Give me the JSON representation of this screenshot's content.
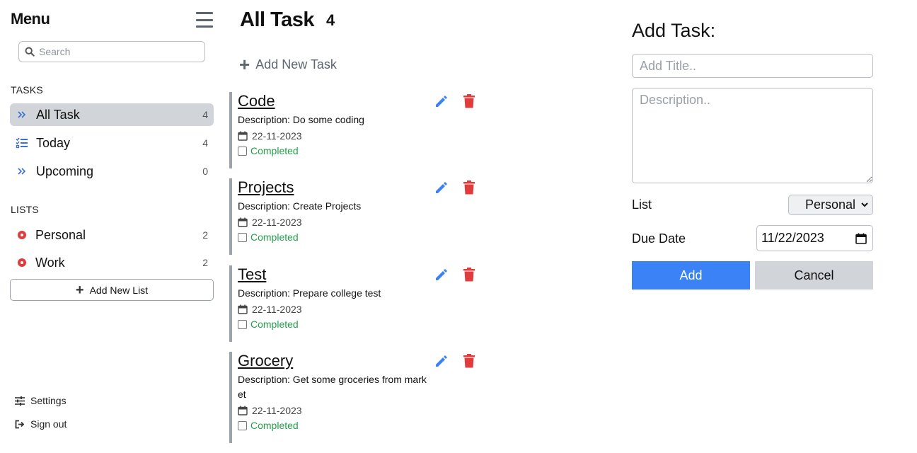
{
  "sidebar": {
    "title": "Menu",
    "search_placeholder": "Search",
    "tasks_label": "TASKS",
    "tasks": [
      {
        "label": "All Task",
        "count": "4",
        "icon": "double-chevron-right-icon"
      },
      {
        "label": "Today",
        "count": "4",
        "icon": "checklist-icon"
      },
      {
        "label": "Upcoming",
        "count": "0",
        "icon": "double-chevron-right-icon"
      }
    ],
    "lists_label": "LISTS",
    "lists": [
      {
        "label": "Personal",
        "count": "2",
        "color": "#e23b3b"
      },
      {
        "label": "Work",
        "count": "2",
        "color": "#e23b3b"
      }
    ],
    "add_list_label": "Add New List",
    "settings_label": "Settings",
    "signout_label": "Sign out"
  },
  "main": {
    "title": "All Task",
    "count": "4",
    "add_task_label": "Add New Task",
    "tasks": [
      {
        "title": "Code",
        "description": "Description: Do some coding",
        "date": "22-11-2023",
        "status": "Completed"
      },
      {
        "title": "Projects",
        "description": "Description: Create Projects",
        "date": "22-11-2023",
        "status": "Completed"
      },
      {
        "title": "Test",
        "description": "Description: Prepare college test",
        "date": "22-11-2023",
        "status": "Completed"
      },
      {
        "title": "Grocery",
        "description": "Description: Get some groceries from market",
        "date": "22-11-2023",
        "status": "Completed"
      }
    ]
  },
  "form": {
    "title": "Add Task:",
    "title_placeholder": "Add Title..",
    "description_placeholder": "Description..",
    "list_label": "List",
    "list_value": "Personal",
    "due_label": "Due Date",
    "due_value": "11/22/2023",
    "add_label": "Add",
    "cancel_label": "Cancel"
  },
  "colors": {
    "accent_blue": "#3b82f6",
    "delete_red": "#e23b3b",
    "completed_green": "#22a04b",
    "active_nav_bg": "#d1d4d9"
  }
}
